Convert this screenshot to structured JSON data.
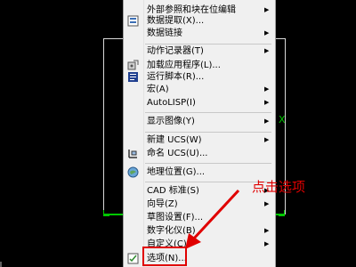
{
  "menu": {
    "items": [
      {
        "label": "外部参照和块在位编辑",
        "submenu": true,
        "icon": ""
      },
      {
        "label": "数据提取(X)...",
        "submenu": false,
        "icon": "data-extract-icon"
      },
      {
        "label": "数据链接",
        "submenu": true,
        "icon": ""
      },
      {
        "label": "动作记录器(T)",
        "submenu": true,
        "icon": ""
      },
      {
        "label": "加载应用程序(L)...",
        "submenu": false,
        "icon": "load-app-icon"
      },
      {
        "label": "运行脚本(R)...",
        "submenu": false,
        "icon": "run-script-icon"
      },
      {
        "label": "宏(A)",
        "submenu": true,
        "icon": ""
      },
      {
        "label": "AutoLISP(I)",
        "submenu": true,
        "icon": ""
      },
      {
        "label": "显示图像(Y)",
        "submenu": true,
        "icon": ""
      },
      {
        "label": "新建 UCS(W)",
        "submenu": true,
        "icon": ""
      },
      {
        "label": "命名 UCS(U)...",
        "submenu": false,
        "icon": "named-ucs-icon"
      },
      {
        "label": "地理位置(G)...",
        "submenu": false,
        "icon": "geolocation-icon"
      },
      {
        "label": "CAD 标准(S)",
        "submenu": true,
        "icon": ""
      },
      {
        "label": "向导(Z)",
        "submenu": true,
        "icon": ""
      },
      {
        "label": "草图设置(F)...",
        "submenu": false,
        "icon": ""
      },
      {
        "label": "数字化仪(B)",
        "submenu": true,
        "icon": ""
      },
      {
        "label": "自定义(C)",
        "submenu": true,
        "icon": ""
      },
      {
        "label": "选项(N)...",
        "submenu": false,
        "icon": "options-icon"
      }
    ]
  },
  "annotation": {
    "text": "点击选项",
    "color": "#e00000"
  },
  "drawing": {
    "axis_mark": "X"
  },
  "colors": {
    "menu_bg": "#f0f0f0",
    "canvas_bg": "#000000",
    "drawing_line": "#00c800",
    "annotation": "#e00000"
  }
}
